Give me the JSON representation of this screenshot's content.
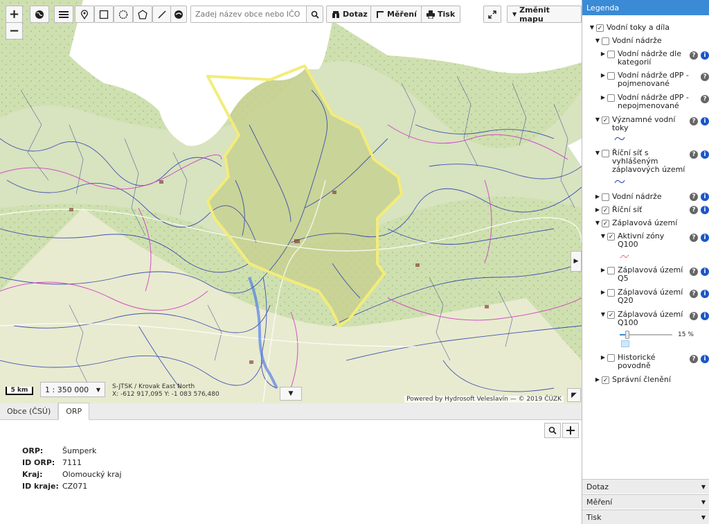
{
  "toolbar": {
    "zoom_in": "+",
    "zoom_out": "−",
    "search_placeholder": "Zadej název obce nebo IČO",
    "query_label": "Dotaz",
    "measure_label": "Měření",
    "print_label": "Tisk",
    "change_map_label": "Změnit mapu"
  },
  "map": {
    "scale_bar": "5 km",
    "scale": "1 : 350 000",
    "crs": "S-JTSK / Krovak East North",
    "coords": "X: -612 917,095 Y: -1 083 576,480",
    "attribution": "Powered by Hydrosoft Veleslavín — © 2019 ČÚZK"
  },
  "bottom_panel": {
    "tabs": [
      "Obce (ČSÚ)",
      "ORP"
    ],
    "active_tab": "ORP",
    "info": [
      {
        "key": "ORP:",
        "value": "Šumperk"
      },
      {
        "key": "ID ORP:",
        "value": "7111"
      },
      {
        "key": "Kraj:",
        "value": "Olomoucký kraj"
      },
      {
        "key": "ID kraje:",
        "value": "CZ071"
      }
    ]
  },
  "legend": {
    "title": "Legenda",
    "items": [
      {
        "label": "Vodní toky a díla",
        "checked": true,
        "expanded": true
      },
      {
        "label": "Vodní nádrže",
        "checked": false,
        "expanded": true
      },
      {
        "label": "Vodní nádrže dle\nkategorií",
        "checked": false,
        "expanded": false
      },
      {
        "label": "Vodní nádrže dPP -\npojmenované",
        "checked": false,
        "expanded": false
      },
      {
        "label": "Vodní nádrže dPP -\nnepojmenované",
        "checked": false,
        "expanded": false
      },
      {
        "label": "Významné vodní\ntoky",
        "checked": true,
        "expanded": true
      },
      {
        "label": "Říční síť s\nvyhlášeným\nzáplavových území",
        "checked": false,
        "expanded": true
      },
      {
        "label": "Vodní nádrže",
        "checked": false,
        "expanded": false
      },
      {
        "label": "Říční síť",
        "checked": true,
        "expanded": false
      },
      {
        "label": "Záplavová území",
        "checked": true,
        "expanded": true
      },
      {
        "label": "Aktivní zóny\nQ100",
        "checked": true,
        "expanded": true
      },
      {
        "label": "Záplavová území\nQ5",
        "checked": false,
        "expanded": false
      },
      {
        "label": "Záplavová území\nQ20",
        "checked": false,
        "expanded": false
      },
      {
        "label": "Záplavová území\nQ100",
        "checked": true,
        "expanded": true
      },
      {
        "label": "Historické\npovodně",
        "checked": false,
        "expanded": false
      },
      {
        "label": "Správní členění",
        "checked": true,
        "expanded": false
      }
    ],
    "opacity": "15 %",
    "opacity_value": 0.15
  },
  "accordion": [
    "Dotaz",
    "Měření",
    "Tisk"
  ],
  "colors": {
    "accent": "#3a8ad6",
    "boundary": "#f3ec7a",
    "river": "#1f3fb0",
    "admin": "#d23cc8"
  }
}
